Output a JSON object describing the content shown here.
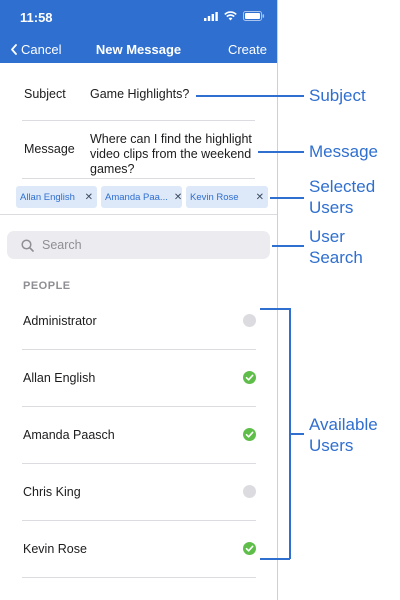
{
  "status_bar": {
    "time": "11:58"
  },
  "nav": {
    "cancel_label": "Cancel",
    "title": "New Message",
    "create_label": "Create"
  },
  "form": {
    "subject_label": "Subject",
    "subject_value": "Game Highlights?",
    "message_label": "Message",
    "message_value": "Where can I find the highlight video clips from the weekend games?"
  },
  "selected_users": [
    {
      "label": "Allan English"
    },
    {
      "label": "Amanda Paa..."
    },
    {
      "label": "Kevin Rose"
    }
  ],
  "search": {
    "placeholder": "Search"
  },
  "people_section": "PEOPLE",
  "people": [
    {
      "name": "Administrator",
      "selected": false
    },
    {
      "name": "Allan English",
      "selected": true
    },
    {
      "name": "Amanda Paasch",
      "selected": true
    },
    {
      "name": "Chris King",
      "selected": false
    },
    {
      "name": "Kevin Rose",
      "selected": true
    }
  ],
  "annotations": {
    "subject": "Subject",
    "message": "Message",
    "selected_users": "Selected Users",
    "user_search": "User Search",
    "available_users": "Available Users"
  },
  "colors": {
    "accent": "#2f6fd0",
    "check_green": "#5fbe4a",
    "chip_bg": "#dde8f8"
  },
  "icons": {
    "chip_remove": "close-icon",
    "search": "search-icon",
    "back": "chevron-left-icon",
    "selected": "check-circle-icon",
    "unselected": "empty-circle-icon"
  }
}
